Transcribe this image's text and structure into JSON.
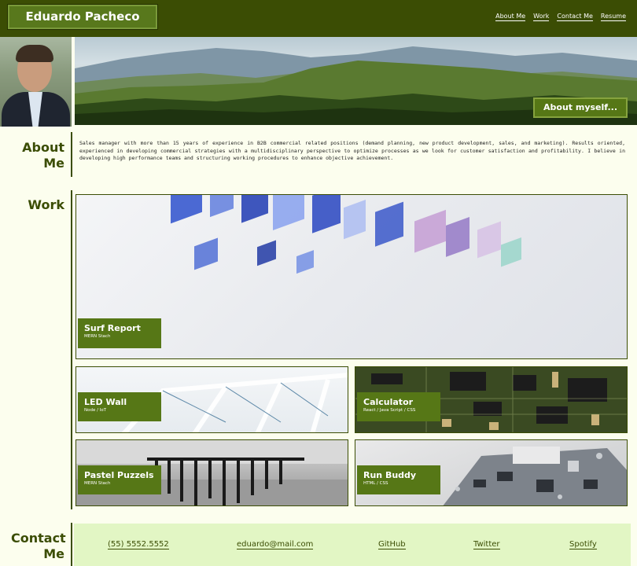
{
  "header": {
    "brand": "Eduardo Pacheco",
    "nav": [
      "About Me",
      "Work",
      "Contact Me",
      "Resume"
    ]
  },
  "hero": {
    "about_button": "About myself..."
  },
  "about": {
    "title": "About Me",
    "text": "Sales manager with more than 15 years of experience in B2B commercial related positions (demand planning, new product development, sales, and marketing). Results oriented, experienced in developing commercial strategies with a multidisciplinary perspective to optimize processes as we look for customer satisfaction and profitability. I believe in developing high performance teams and structuring working procedures to enhance objective achievement."
  },
  "work": {
    "title": "Work",
    "projects": [
      {
        "name": "Surf Report",
        "stack": "MERN Stach"
      },
      {
        "name": "LED Wall",
        "stack": "Node / IoT"
      },
      {
        "name": "Calculator",
        "stack": "React / Java Script / CSS"
      },
      {
        "name": "Pastel Puzzels",
        "stack": "MERN Stach"
      },
      {
        "name": "Run Buddy",
        "stack": "HTML / CSS"
      }
    ]
  },
  "contact": {
    "title": "Contact Me",
    "links": [
      "(55) 5552.5552",
      "eduardo@mail.com",
      "GitHub",
      "Twitter",
      "Spotify"
    ]
  },
  "colors": {
    "header": "#3b4d04",
    "accent": "#567716",
    "background": "#fcfeee",
    "contact_bar": "#e2f6c4"
  }
}
